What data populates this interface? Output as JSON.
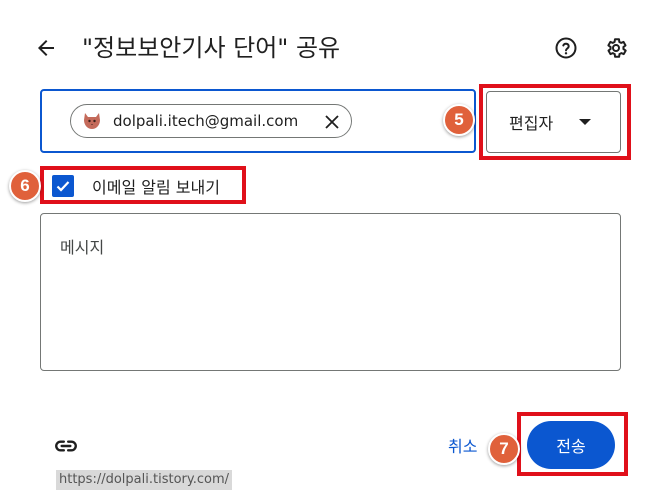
{
  "dialog": {
    "title": "\"정보보안기사 단어\" 공유",
    "back_icon": "arrow-back-icon",
    "help_icon": "help-circle-icon",
    "settings_icon": "gear-icon"
  },
  "recipient": {
    "email": "dolpali.itech@gmail.com",
    "avatar_icon": "cat-avatar-icon",
    "remove_icon": "close-icon"
  },
  "role": {
    "selected": "편집자",
    "caret_icon": "caret-down-icon"
  },
  "notify": {
    "checked": true,
    "label": "이메일 알림 보내기"
  },
  "message": {
    "placeholder": "메시지"
  },
  "footer": {
    "link_icon": "link-icon",
    "cancel_label": "취소",
    "send_label": "전송",
    "watermark": "https://dolpali.tistory.com/"
  },
  "annotations": {
    "step_5": "5",
    "step_6": "6",
    "step_7": "7",
    "highlight_color": "#e0101a",
    "badge_color": "#e0613b"
  },
  "colors": {
    "accent": "#0b57d0",
    "text": "#1f1f1f",
    "border": "#747775"
  }
}
